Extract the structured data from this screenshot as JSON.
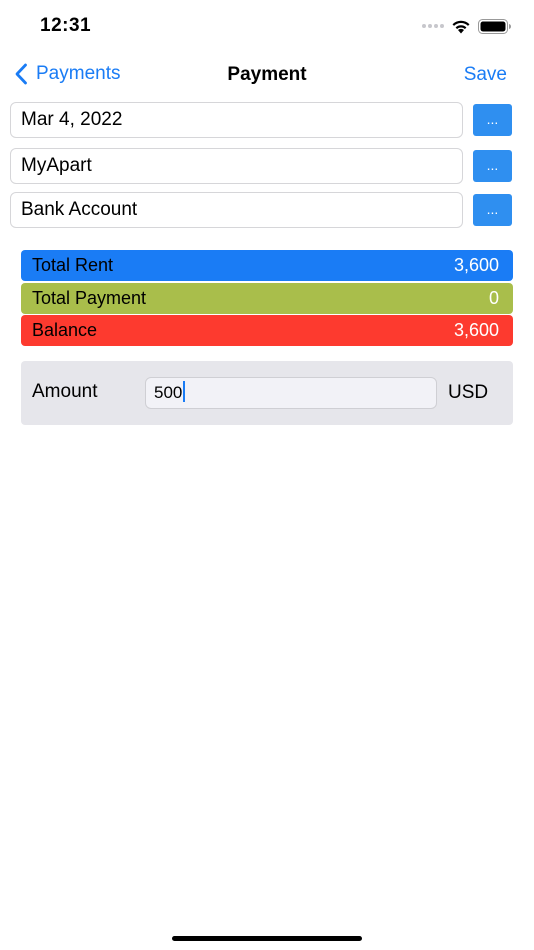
{
  "status_bar": {
    "time": "12:31",
    "icons": [
      "signal-dots-icon",
      "wifi-icon",
      "battery-icon"
    ]
  },
  "nav": {
    "back_label": "Payments",
    "back_icon": "chevron-left-icon",
    "title": "Payment",
    "save_label": "Save"
  },
  "pickers": {
    "date": {
      "value": "Mar 4, 2022",
      "button_label": "..."
    },
    "property": {
      "value": "MyApart",
      "button_label": "..."
    },
    "account": {
      "value": "Bank Account",
      "button_label": "..."
    }
  },
  "summary": {
    "total_rent": {
      "label": "Total Rent",
      "value": "3,600",
      "color": "#1a7cf5"
    },
    "total_payment": {
      "label": "Total Payment",
      "value": "0",
      "color": "#a9be4b"
    },
    "balance": {
      "label": "Balance",
      "value": "3,600",
      "color": "#fd3a2f"
    }
  },
  "amount": {
    "label": "Amount",
    "value": "500",
    "currency": "USD"
  },
  "colors": {
    "accent": "#1a7cf5",
    "picker_button": "#2f8ff0",
    "panel_background": "#e6e6eb"
  }
}
